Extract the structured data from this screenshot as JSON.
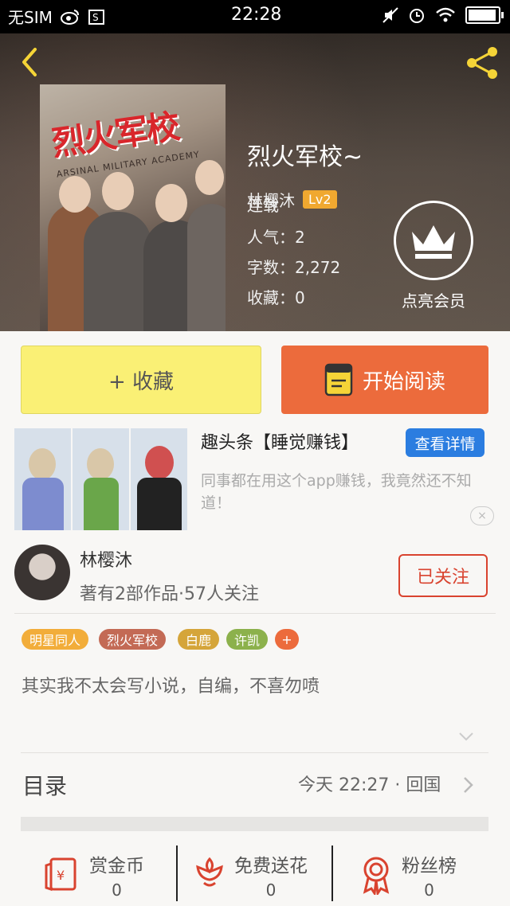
{
  "status_bar": {
    "carrier": "无SIM",
    "time": "22:28",
    "battery_level": 0.95
  },
  "book": {
    "title": "烈火军校~",
    "author": "林樱沐",
    "level": "Lv2",
    "status": "连载",
    "popularity": "人气：2",
    "word_count": "字数：2,272",
    "favorites": "收藏：0",
    "cover_title": "烈火军校",
    "cover_subtitle": "ARSINAL MILITARY ACADEMY",
    "vip_label": "点亮会员"
  },
  "actions": {
    "collect": "+ 收藏",
    "read": "开始阅读"
  },
  "ad": {
    "title": "趣头条【睡觉赚钱】",
    "button": "查看详情",
    "description": "同事都在用这个app赚钱，我竟然还不知道！",
    "close": "×"
  },
  "author_info": {
    "name": "林樱沐",
    "stats": "著有2部作品·57人关注",
    "follow_button": "已关注"
  },
  "tags": [
    {
      "label": "明星同人",
      "color": "#f2ad3a"
    },
    {
      "label": "烈火军校",
      "color": "#c36a55"
    },
    {
      "label": "白鹿",
      "color": "#d5a53a"
    },
    {
      "label": "许凯",
      "color": "#8cb14c"
    },
    {
      "label": "+",
      "color": "#ec6b3c"
    }
  ],
  "description": "其实我不太会写小说，自编，不喜勿喷",
  "toc": {
    "label": "目录",
    "latest": "今天 22:27 · 回国"
  },
  "bottom_bar": [
    {
      "label": "赏金币",
      "value": "0",
      "icon": "red-envelope-icon"
    },
    {
      "label": "免费送花",
      "value": "0",
      "icon": "flower-icon"
    },
    {
      "label": "粉丝榜",
      "value": "0",
      "icon": "medal-icon"
    }
  ],
  "colors": {
    "accent_orange": "#ec6b3c",
    "collect_yellow": "#faf075",
    "follow_red": "#d9432f",
    "ad_blue": "#2b7de0",
    "icon_red": "#d9432f"
  }
}
